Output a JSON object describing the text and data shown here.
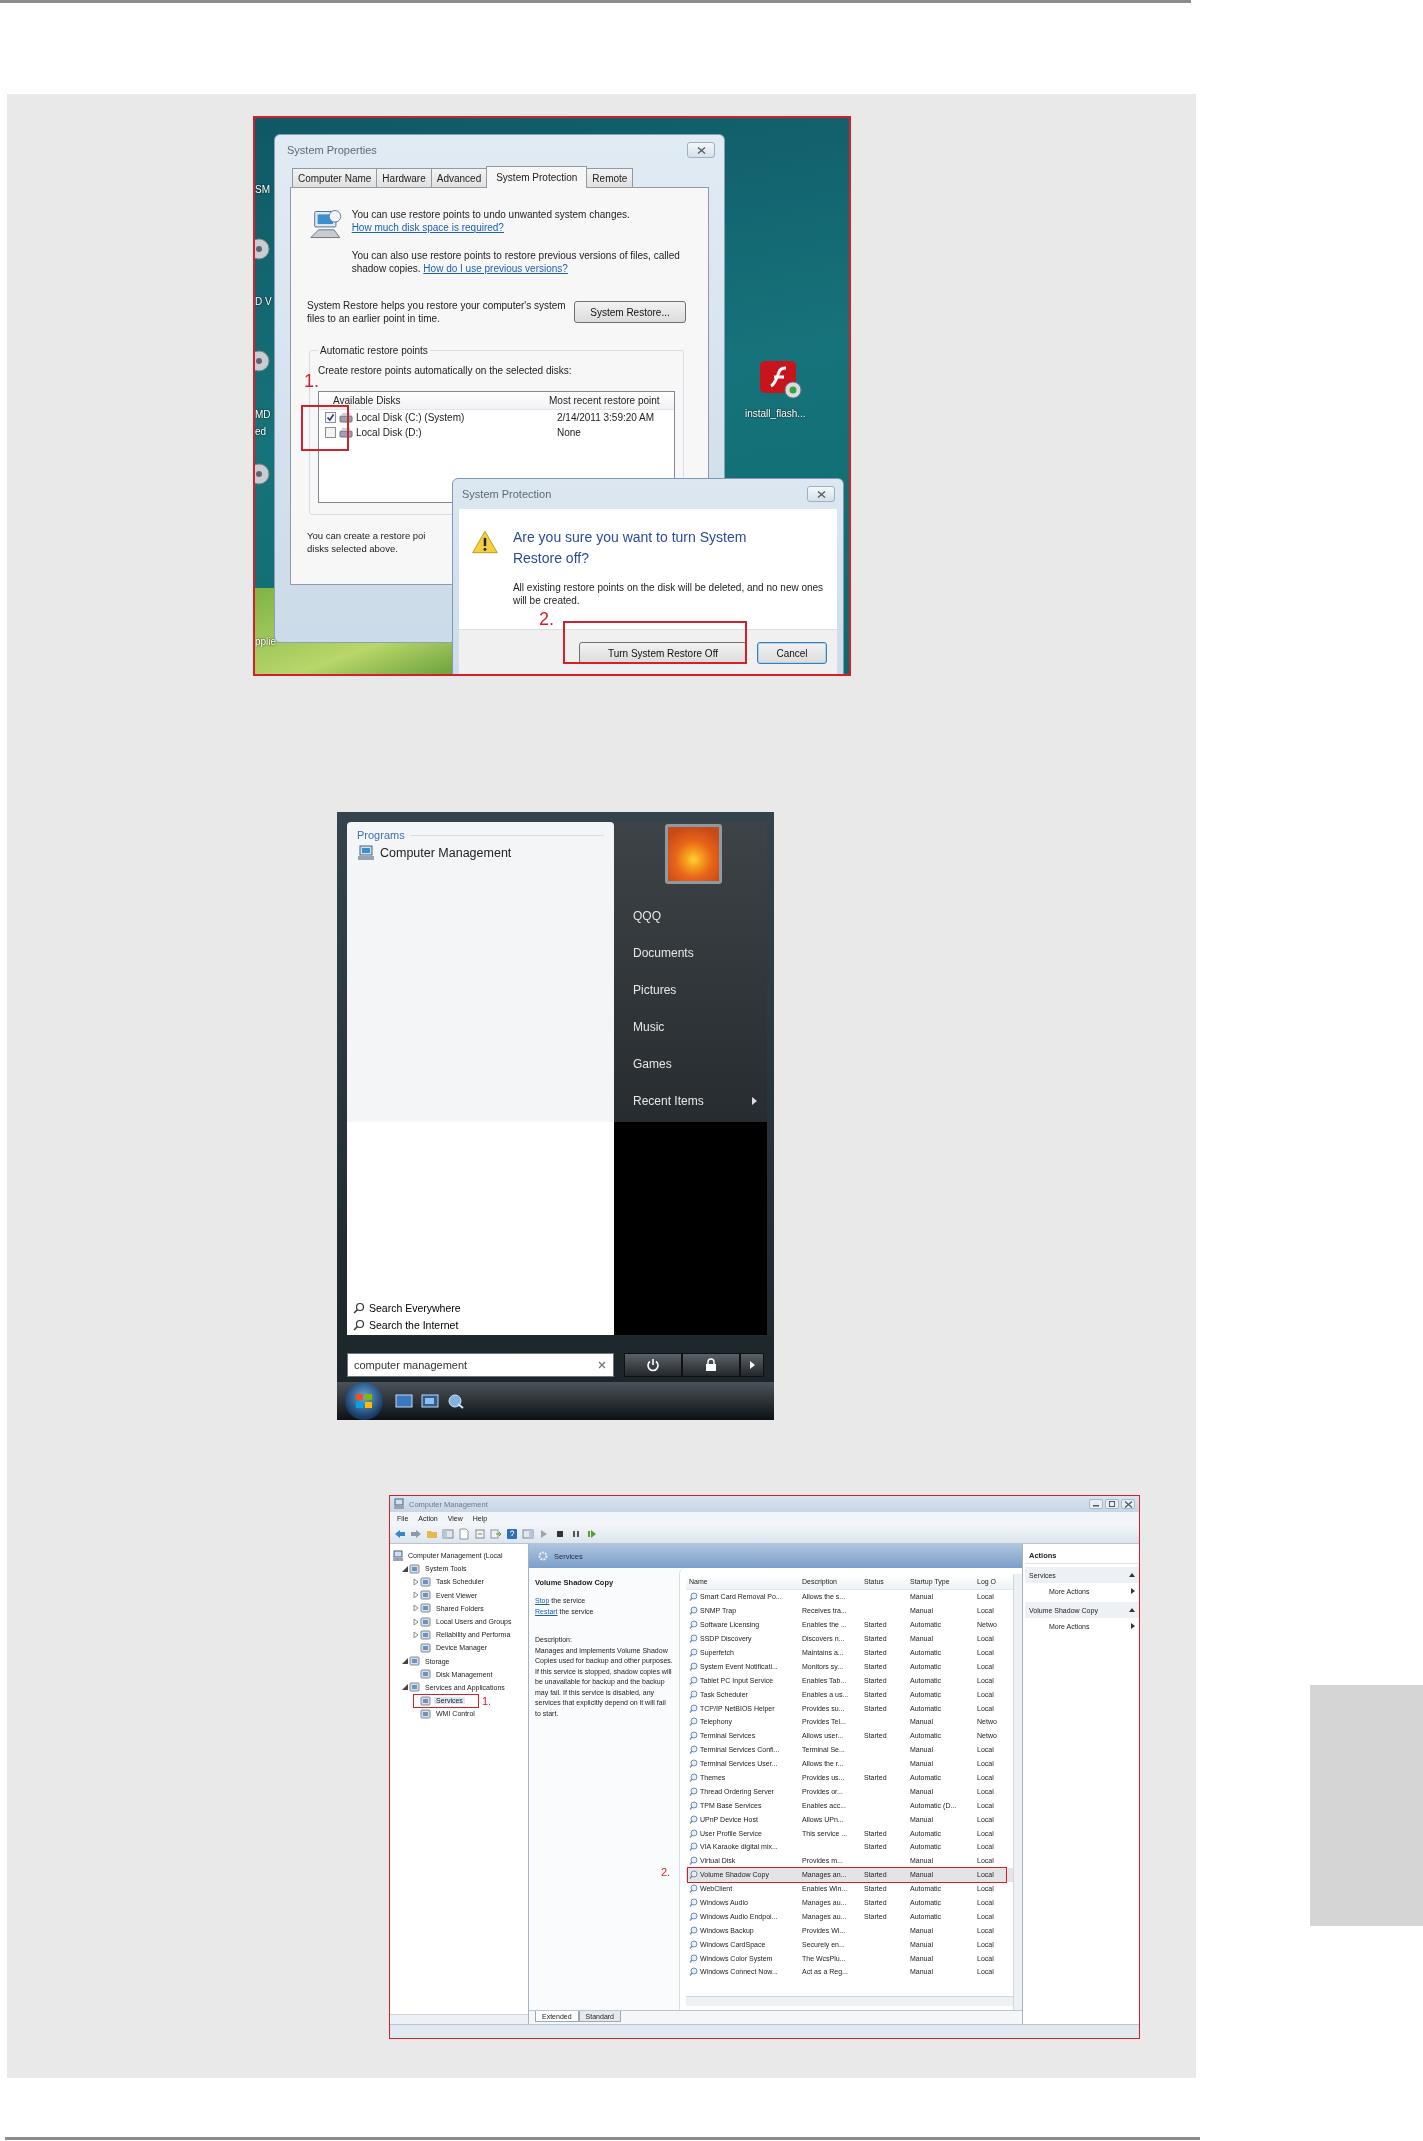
{
  "screenshot_1": {
    "desktop_edge_labels": [
      "SM",
      "D V",
      "MD",
      "ed",
      "pplie"
    ],
    "desktop_icon_label": "install_flash...",
    "system_properties": {
      "title": "System Properties",
      "tabs": [
        {
          "label": "Computer Name",
          "selected": false
        },
        {
          "label": "Hardware",
          "selected": false
        },
        {
          "label": "Advanced",
          "selected": false
        },
        {
          "label": "System Protection",
          "selected": true
        },
        {
          "label": "Remote",
          "selected": false
        }
      ],
      "intro_text": "You can use restore points to undo unwanted system changes.",
      "intro_link": "How much disk space is required?",
      "shadow_text": "You can also use restore points to restore previous versions of files, called shadow copies.",
      "shadow_link": "How do I use previous versions?",
      "restore_text": "System Restore helps you restore your computer's system files to an earlier point in time.",
      "restore_button": "System Restore...",
      "group_title": "Automatic restore points",
      "group_text": "Create restore points automatically on the selected disks:",
      "columns": [
        "Available Disks",
        "Most recent restore point"
      ],
      "disks": [
        {
          "name": "Local Disk (C:) (System)",
          "restore_point": "2/14/2011 3:59:20 AM",
          "checked": true
        },
        {
          "name": "Local Disk (D:)",
          "restore_point": "None",
          "checked": false
        }
      ],
      "footer_text": "You can create a restore poi\ndisks selected above."
    },
    "confirm_dialog": {
      "title": "System Protection",
      "question": "Are you sure you want to turn System Restore off?",
      "detail": "All existing restore points on the disk will be deleted, and no new ones will be created.",
      "buttons": [
        {
          "label": "Turn System Restore Off",
          "focused": false
        },
        {
          "label": "Cancel",
          "focused": true
        }
      ]
    },
    "step_labels": [
      "1.",
      "2."
    ]
  },
  "screenshot_2": {
    "programs_header": "Programs",
    "programs": [
      "Computer Management"
    ],
    "places": [
      {
        "label": "QQQ",
        "submenu": false
      },
      {
        "label": "Documents",
        "submenu": false
      },
      {
        "label": "Pictures",
        "submenu": false
      },
      {
        "label": "Music",
        "submenu": false
      },
      {
        "label": "Games",
        "submenu": false
      },
      {
        "label": "Recent Items",
        "submenu": true
      }
    ],
    "search_links": [
      "Search Everywhere",
      "Search the Internet"
    ],
    "search_field": {
      "value": "computer management"
    }
  },
  "screenshot_3": {
    "title": "Computer Management",
    "menu": [
      "File",
      "Action",
      "View",
      "Help"
    ],
    "tree": [
      {
        "label": "Computer Management (Local",
        "selected": false,
        "children": [
          {
            "label": "System Tools",
            "expanded": true,
            "selected": false,
            "children": [
              {
                "label": "Task Scheduler",
                "expanded": false,
                "selected": false
              },
              {
                "label": "Event Viewer",
                "expanded": false,
                "selected": false
              },
              {
                "label": "Shared Folders",
                "expanded": false,
                "selected": false
              },
              {
                "label": "Local Users and Groups",
                "expanded": false,
                "selected": false
              },
              {
                "label": "Reliability and Performa",
                "expanded": false,
                "selected": false
              },
              {
                "label": "Device Manager",
                "selected": false
              }
            ]
          },
          {
            "label": "Storage",
            "expanded": true,
            "selected": false,
            "children": [
              {
                "label": "Disk Management",
                "selected": false
              }
            ]
          },
          {
            "label": "Services and Applications",
            "expanded": true,
            "selected": false,
            "children": [
              {
                "label": "Services",
                "selected": true
              },
              {
                "label": "WMI Control",
                "selected": false
              }
            ]
          }
        ]
      }
    ],
    "pane_header": "Services",
    "detail": {
      "title": "Volume Shadow Copy",
      "actions": [
        {
          "link": "Stop",
          "text": "the service"
        },
        {
          "link": "Restart",
          "text": "the service"
        }
      ],
      "description_label": "Description:",
      "description": "Manages and implements Volume Shadow Copies used for backup and other purposes. If this service is stopped, shadow copies will be unavailable for backup and the backup may fail. If this service is disabled, any services that explicitly depend on it will fail to start."
    },
    "columns": [
      "Name",
      "Description",
      "Status",
      "Startup Type",
      "Log O"
    ],
    "rows": [
      {
        "name": "Smart Card Removal Po...",
        "description": "Allows the s...",
        "startup_type": "Manual",
        "log_on": "Local",
        "selected": false
      },
      {
        "name": "SNMP Trap",
        "description": "Receives tra...",
        "startup_type": "Manual",
        "log_on": "Local",
        "selected": false
      },
      {
        "name": "Software Licensing",
        "description": "Enables the ...",
        "status": "Started",
        "startup_type": "Automatic",
        "log_on": "Netwo",
        "selected": false
      },
      {
        "name": "SSDP Discovery",
        "description": "Discovers n...",
        "status": "Started",
        "startup_type": "Manual",
        "log_on": "Local",
        "selected": false
      },
      {
        "name": "Superfetch",
        "description": "Maintains a...",
        "status": "Started",
        "startup_type": "Automatic",
        "log_on": "Local",
        "selected": false
      },
      {
        "name": "System Event Notificati...",
        "description": "Monitors sy...",
        "status": "Started",
        "startup_type": "Automatic",
        "log_on": "Local",
        "selected": false
      },
      {
        "name": "Tablet PC Input Service",
        "description": "Enables Tab...",
        "status": "Started",
        "startup_type": "Automatic",
        "log_on": "Local",
        "selected": false
      },
      {
        "name": "Task Scheduler",
        "description": "Enables a us...",
        "status": "Started",
        "startup_type": "Automatic",
        "log_on": "Local",
        "selected": false
      },
      {
        "name": "TCP/IP NetBIOS Helper",
        "description": "Provides su...",
        "status": "Started",
        "startup_type": "Automatic",
        "log_on": "Local",
        "selected": false
      },
      {
        "name": "Telephony",
        "description": "Provides Tel...",
        "startup_type": "Manual",
        "log_on": "Netwo",
        "selected": false
      },
      {
        "name": "Terminal Services",
        "description": "Allows user...",
        "status": "Started",
        "startup_type": "Automatic",
        "log_on": "Netwo",
        "selected": false
      },
      {
        "name": "Terminal Services Confi...",
        "description": "Terminal Se...",
        "startup_type": "Manual",
        "log_on": "Local",
        "selected": false
      },
      {
        "name": "Terminal Services User...",
        "description": "Allows the r...",
        "startup_type": "Manual",
        "log_on": "Local",
        "selected": false
      },
      {
        "name": "Themes",
        "description": "Provides us...",
        "status": "Started",
        "startup_type": "Automatic",
        "log_on": "Local",
        "selected": false
      },
      {
        "name": "Thread Ordering Server",
        "description": "Provides or...",
        "startup_type": "Manual",
        "log_on": "Local",
        "selected": false
      },
      {
        "name": "TPM Base Services",
        "description": "Enables acc...",
        "startup_type": "Automatic (D...",
        "log_on": "Local",
        "selected": false
      },
      {
        "name": "UPnP Device Host",
        "description": "Allows UPn...",
        "startup_type": "Manual",
        "log_on": "Local",
        "selected": false
      },
      {
        "name": "User Profile Service",
        "description": "This service ...",
        "status": "Started",
        "startup_type": "Automatic",
        "log_on": "Local",
        "selected": false
      },
      {
        "name": "VIA Karaoke digital mix...",
        "status": "Started",
        "startup_type": "Automatic",
        "log_on": "Local",
        "selected": false
      },
      {
        "name": "Virtual Disk",
        "description": "Provides m...",
        "startup_type": "Manual",
        "log_on": "Local",
        "selected": false
      },
      {
        "name": "Volume Shadow Copy",
        "description": "Manages an...",
        "status": "Started",
        "startup_type": "Manual",
        "log_on": "Local",
        "selected": true
      },
      {
        "name": "WebClient",
        "description": "Enables Win...",
        "status": "Started",
        "startup_type": "Automatic",
        "log_on": "Local",
        "selected": false
      },
      {
        "name": "Windows Audio",
        "description": "Manages au...",
        "status": "Started",
        "startup_type": "Automatic",
        "log_on": "Local",
        "selected": false
      },
      {
        "name": "Windows Audio Endpoi...",
        "description": "Manages au...",
        "status": "Started",
        "startup_type": "Automatic",
        "log_on": "Local",
        "selected": false
      },
      {
        "name": "Windows Backup",
        "description": "Provides Wi...",
        "startup_type": "Manual",
        "log_on": "Local",
        "selected": false
      },
      {
        "name": "Windows CardSpace",
        "description": "Securely en...",
        "startup_type": "Manual",
        "log_on": "Local",
        "selected": false
      },
      {
        "name": "Windows Color System",
        "description": "The WcsPlu...",
        "startup_type": "Manual",
        "log_on": "Local",
        "selected": false
      },
      {
        "name": "Windows Connect Now...",
        "description": "Act as a Reg...",
        "startup_type": "Manual",
        "log_on": "Local",
        "selected": false
      }
    ],
    "view_tabs": [
      {
        "label": "Extended",
        "selected": true
      },
      {
        "label": "Standard",
        "selected": false
      }
    ],
    "actions_pane": {
      "title": "Actions",
      "sections": [
        {
          "label": "Services",
          "items": [
            "More Actions"
          ]
        },
        {
          "label": "Volume Shadow Copy",
          "items": [
            "More Actions"
          ]
        }
      ]
    },
    "step_labels": [
      "1.",
      "2."
    ]
  }
}
